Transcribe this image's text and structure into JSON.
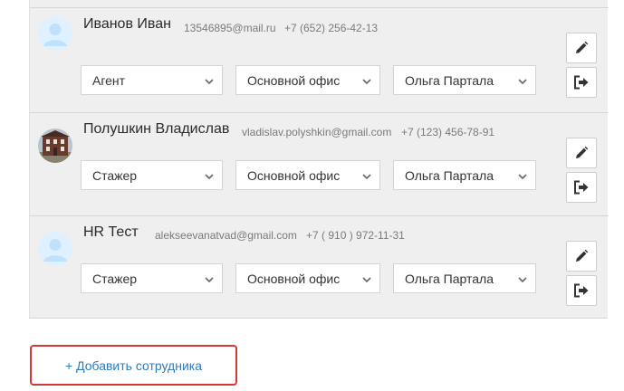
{
  "employees": [
    {
      "name": "Иванов Иван",
      "email": "13546895@mail.ru",
      "phone": "+7 (652) 256-42-13",
      "avatar": "person-placeholder-icon",
      "role": "Агент",
      "office": "Основной офис",
      "manager": "Ольга Партала"
    },
    {
      "name": "Полушкин Владислав",
      "email": "vladislav.polyshkin@gmail.com",
      "phone": "+7 (123) 456-78-91",
      "avatar": "building-photo",
      "role": "Стажер",
      "office": "Основной офис",
      "manager": "Ольга Партала"
    },
    {
      "name": "HR Тест",
      "email": "alekseevanatvad@gmail.com",
      "phone": "+7 ( 910 ) 972-11-31",
      "avatar": "person-placeholder-icon",
      "role": "Стажер",
      "office": "Основной офис",
      "manager": "Ольга Партала"
    }
  ],
  "add_button": {
    "label": "+ Добавить сотрудника"
  },
  "colors": {
    "list_background": "#efefef",
    "link": "#2a7bc0",
    "highlight_border": "#d23a3a",
    "avatar_placeholder": "#bfe1fb"
  }
}
